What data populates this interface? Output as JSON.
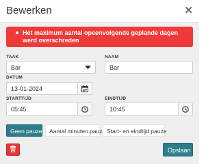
{
  "dialog": {
    "title": "Bewerken",
    "close_icon": "close-icon"
  },
  "alert": {
    "message": "Het maximum aantal opeenvolgende geplande dagen werd overschreden",
    "color": "#ef3a3a"
  },
  "form": {
    "taak": {
      "label": "TAAK",
      "value": "Bar",
      "icon": "caret-down-icon"
    },
    "naam": {
      "label": "NAAM",
      "value": "Bar"
    },
    "datum": {
      "label": "DATUM",
      "value": "13-01-2024",
      "icon": "calendar-icon"
    },
    "starttijd": {
      "label": "STARTTIJD",
      "value": "05:45",
      "icon": "clock-icon"
    },
    "eindtijd": {
      "label": "EINDTIJD",
      "value": "10:45",
      "icon": "clock-icon"
    }
  },
  "pause_options": {
    "items": [
      {
        "label": "Geen pauze",
        "active": true
      },
      {
        "label": "Aantal minuten pauze",
        "active": false
      },
      {
        "label": "Start- en eindtijd pauze",
        "active": false
      }
    ],
    "active_color": "#2e7d8a"
  },
  "footer": {
    "delete_icon": "trash-icon",
    "save_label": "Opslaan"
  }
}
